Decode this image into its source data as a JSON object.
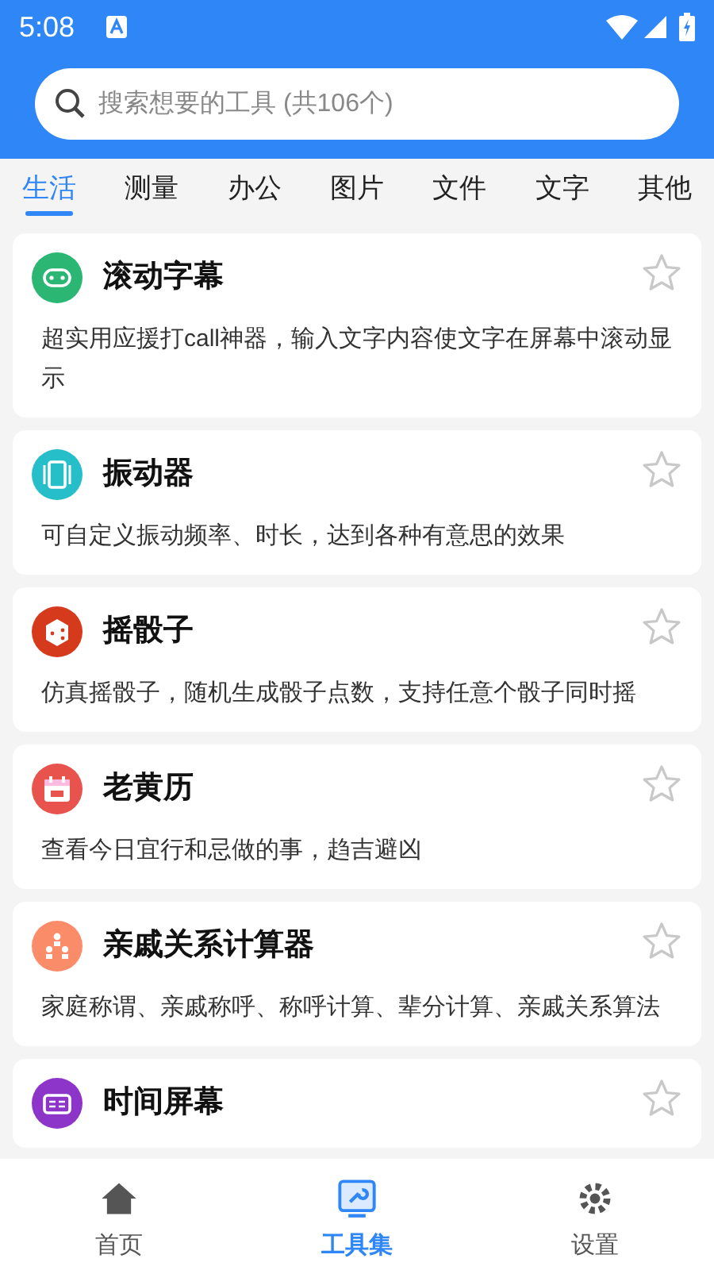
{
  "status_bar": {
    "time": "5:08"
  },
  "search": {
    "placeholder": "搜索想要的工具 (共106个)"
  },
  "tabs": [
    {
      "label": "生活",
      "selected": true
    },
    {
      "label": "测量",
      "selected": false
    },
    {
      "label": "办公",
      "selected": false
    },
    {
      "label": "图片",
      "selected": false
    },
    {
      "label": "文件",
      "selected": false
    },
    {
      "label": "文字",
      "selected": false
    },
    {
      "label": "其他",
      "selected": false
    }
  ],
  "tools": [
    {
      "kind": "led",
      "color": "#2bb673",
      "title": "滚动字幕",
      "description": "超实用应援打call神器，输入文字内容使文字在屏幕中滚动显示",
      "starred": false
    },
    {
      "kind": "vibrate",
      "color": "#26bfc9",
      "title": "振动器",
      "description": "可自定义振动频率、时长，达到各种有意思的效果",
      "starred": false
    },
    {
      "kind": "dice",
      "color": "#d63a1c",
      "title": "摇骰子",
      "description": "仿真摇骰子，随机生成骰子点数，支持任意个骰子同时摇",
      "starred": false
    },
    {
      "kind": "calendar",
      "color": "#e8544d",
      "title": "老黄历",
      "description": "查看今日宜行和忌做的事，趋吉避凶",
      "starred": false
    },
    {
      "kind": "family",
      "color": "#fb8c6a",
      "title": "亲戚关系计算器",
      "description": "家庭称谓、亲戚称呼、称呼计算、辈分计算、亲戚关系算法",
      "starred": false
    },
    {
      "kind": "clock",
      "color": "#8e35c9",
      "title": "时间屏幕",
      "starred": false
    }
  ],
  "bottom_nav": [
    {
      "kind": "home",
      "label": "首页",
      "selected": false
    },
    {
      "kind": "tools",
      "label": "工具集",
      "selected": true
    },
    {
      "kind": "settings",
      "label": "设置",
      "selected": false
    }
  ]
}
